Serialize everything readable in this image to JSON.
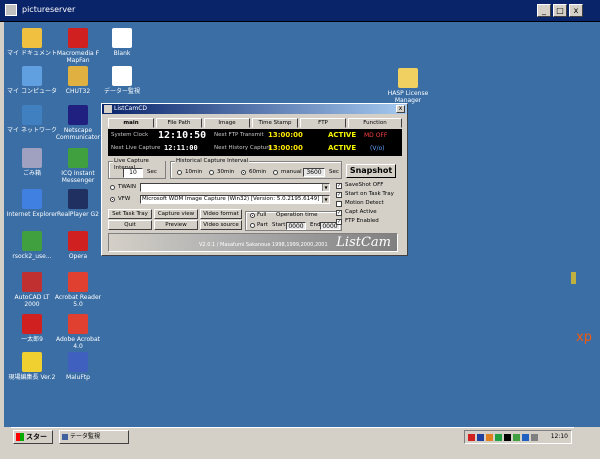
{
  "window_title": "pictureserver",
  "title_buttons": {
    "minimize": "_",
    "restore": "□",
    "close": "x"
  },
  "desktop_icons": [
    {
      "label": "マイ ドキュメント",
      "color": "#f0c040"
    },
    {
      "label": "Macromedia F MapFan",
      "color": "#d02020"
    },
    {
      "label": "Blank",
      "color": "#ffffff"
    },
    {
      "label": "マイ コンピュータ",
      "color": "#60a0e0"
    },
    {
      "label": "CHUT32",
      "color": "#e0b040"
    },
    {
      "label": "データー監視",
      "color": "#ffffff"
    },
    {
      "label": "HASP License Manager",
      "color": "#f0d060"
    },
    {
      "label": "マイ ネットワーク",
      "color": "#4080c0"
    },
    {
      "label": "Netscape Communicator",
      "color": "#202080"
    },
    {
      "label": "ごみ箱",
      "color": "#a0a0c0"
    },
    {
      "label": "ICQ Instant Messenger",
      "color": "#40a040"
    },
    {
      "label": "Internet Explorer",
      "color": "#4080e0"
    },
    {
      "label": "RealPlayer G2",
      "color": "#203060"
    },
    {
      "label": "rsock2_use...",
      "color": "#40a040"
    },
    {
      "label": "Opera",
      "color": "#d02020"
    },
    {
      "label": "AutoCAD LT 2000",
      "color": "#c03030"
    },
    {
      "label": "Acrobat Reader 5.0",
      "color": "#e04030"
    },
    {
      "label": "一太郎9",
      "color": "#d02020"
    },
    {
      "label": "Adobe Acrobat 4.0",
      "color": "#e04030"
    },
    {
      "label": "現場編集長 Ver.2",
      "color": "#f0d030"
    },
    {
      "label": "MaluFtp",
      "color": "#4060c0"
    }
  ],
  "listcam": {
    "title": "ListCamCD",
    "close": "x",
    "tabs": [
      "main",
      "File Path",
      "Image",
      "Time Stamp",
      "FTP",
      "Function"
    ],
    "panel": {
      "system_clock_label": "System Clock",
      "system_clock": "12:10:50",
      "next_ftp_label": "Next FTP Transmit",
      "next_ftp": "13:00:00",
      "active_1": "ACTIVE",
      "md_off": "MD OFF",
      "next_live_label": "Next Live Capture",
      "next_live": "12:11:00",
      "next_history_label": "Next History Capture",
      "next_history": "13:00:00",
      "active_2": "ACTIVE",
      "version": "(V/o)"
    },
    "live_interval_label": "Live Capture Interval",
    "live_interval_value": "10",
    "live_interval_unit": "Sec",
    "history_interval_label": "Historical Capture Interval",
    "history_options": [
      "10min",
      "30min",
      "60min",
      "manual"
    ],
    "history_manual_value": "3600",
    "history_unit": "Sec",
    "snapshot": "Snapshot",
    "twain_label": "TWAIN",
    "vfw_label": "VFW",
    "vfw_device": "Microsoft WDM Image Capture (Win32) [Version: 5.0.2195.6149]",
    "buttons_row1": [
      "Set Task Tray",
      "Capture view",
      "Video format"
    ],
    "buttons_row2": [
      "Quit",
      "Preview",
      "Video source"
    ],
    "operation_time_label": "Operation time",
    "op_full": "Full",
    "op_part": "Part",
    "op_start_label": "Start",
    "op_start_value": "0000",
    "op_end_label": "End",
    "op_end_value": "0000",
    "checks": [
      {
        "label": "SaveShot OFF",
        "checked": true
      },
      {
        "label": "Start on Task Tray",
        "checked": true
      },
      {
        "label": "Motion Detect",
        "checked": false
      },
      {
        "label": "Capt Active",
        "checked": true
      },
      {
        "label": "FTP Enabled",
        "checked": true
      }
    ],
    "copyright": "V2.0.1 / Masafumi Sakanoue 1998,1999,2000,2001",
    "logo": "ListCam"
  },
  "taskbar": {
    "start": "スタート",
    "task": "テータ監視",
    "clock": "12:10"
  },
  "side_label": "xp"
}
